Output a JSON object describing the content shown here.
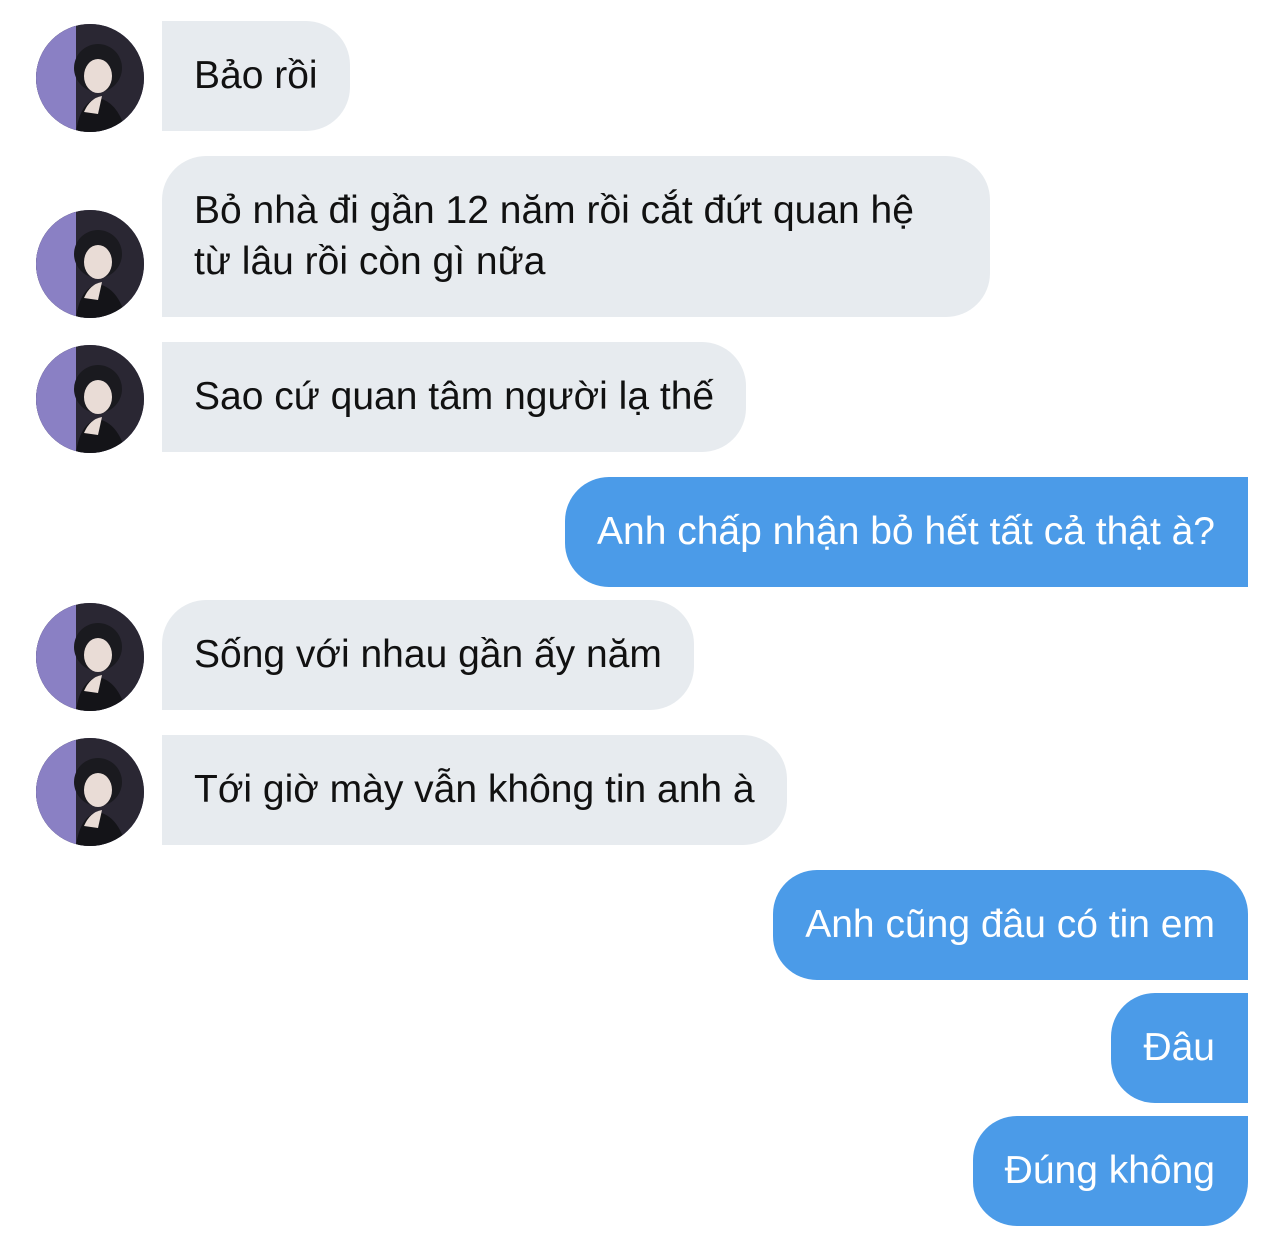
{
  "conversation": {
    "messages": [
      {
        "from": "them",
        "text": "Bảo rồi"
      },
      {
        "from": "them",
        "text": "Bỏ nhà đi gần 12 năm rồi cắt đứt quan hệ từ lâu rồi còn gì nữa"
      },
      {
        "from": "them",
        "text": "Sao cứ quan tâm người lạ thế"
      },
      {
        "from": "me",
        "text": "Anh chấp nhận bỏ hết tất cả thật à?"
      },
      {
        "from": "them",
        "text": "Sống với nhau gần ấy năm"
      },
      {
        "from": "them",
        "text": "Tới giờ mày vẫn không tin anh à"
      },
      {
        "from": "me",
        "text": "Anh cũng đâu có tin em"
      },
      {
        "from": "me",
        "text": "Đâu"
      },
      {
        "from": "me",
        "text": "Đúng không"
      }
    ]
  },
  "colors": {
    "incoming_bubble": "#e7ebef",
    "outgoing_bubble": "#4b9be8",
    "incoming_text": "#111111",
    "outgoing_text": "#ffffff",
    "background": "#ffffff"
  },
  "icons": {
    "avatar": "contact-avatar-photo"
  }
}
